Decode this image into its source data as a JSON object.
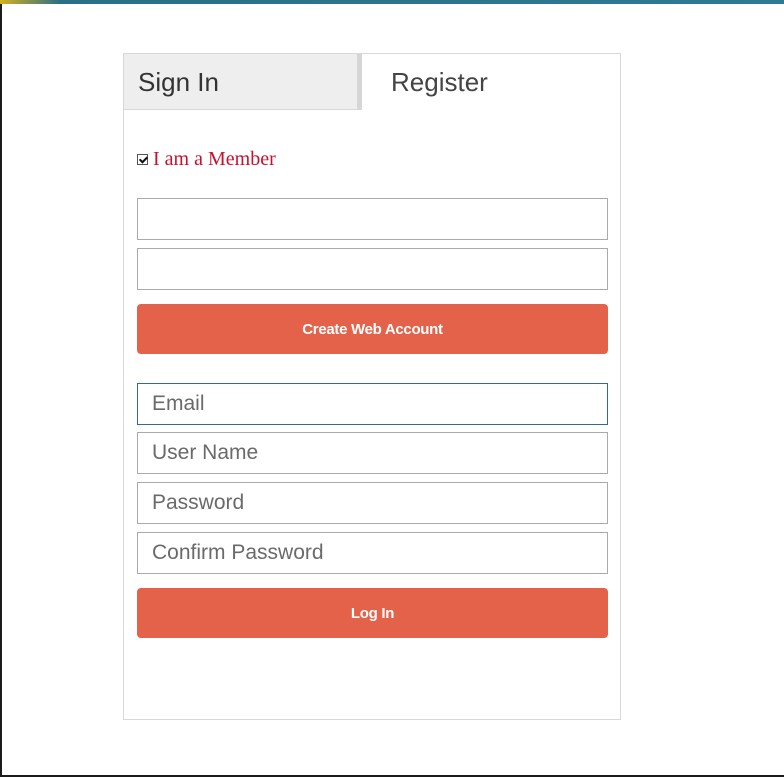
{
  "tabs": {
    "sign_in": "Sign In",
    "register": "Register"
  },
  "member_checkbox": {
    "label": "I am a Member",
    "checked": true
  },
  "member_fields": [
    {
      "value": "",
      "placeholder": ""
    },
    {
      "value": "",
      "placeholder": ""
    }
  ],
  "create_account_button": "Create Web Account",
  "register_fields": {
    "email_placeholder": "Email",
    "username_placeholder": "User Name",
    "password_placeholder": "Password",
    "confirm_password_placeholder": "Confirm Password"
  },
  "login_button": "Log In",
  "colors": {
    "accent": "#e4624a",
    "member_label": "#c8102e",
    "focus_border": "#2f6d93"
  }
}
